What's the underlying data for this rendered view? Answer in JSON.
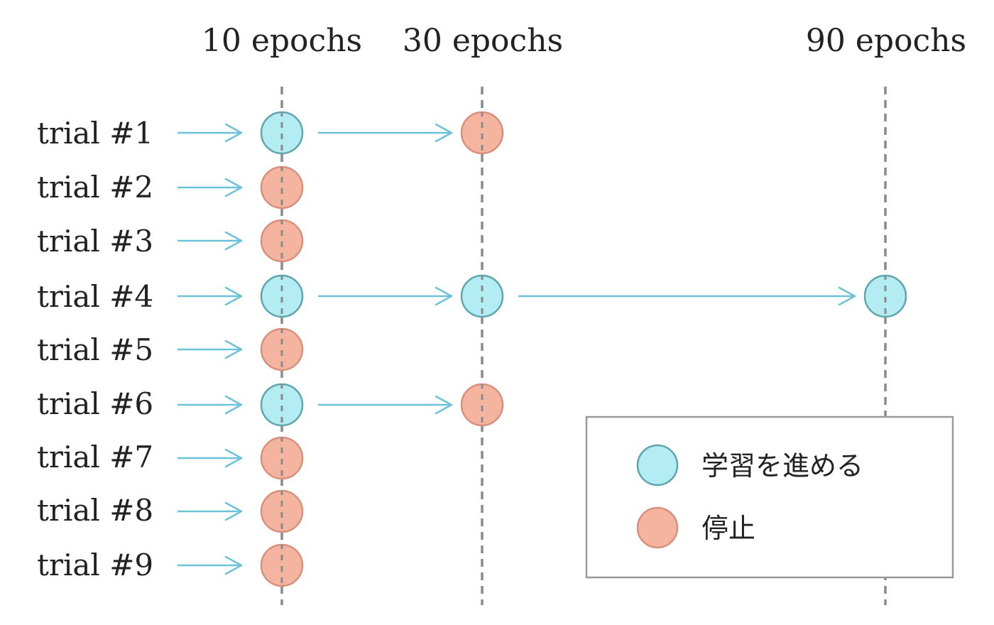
{
  "columns": [
    {
      "label": "10 epochs"
    },
    {
      "label": "30 epochs"
    },
    {
      "label": "90 epochs"
    }
  ],
  "trials": [
    {
      "label": "trial #1",
      "stages": [
        "continue",
        "stop"
      ]
    },
    {
      "label": "trial #2",
      "stages": [
        "stop"
      ]
    },
    {
      "label": "trial #3",
      "stages": [
        "stop"
      ]
    },
    {
      "label": "trial #4",
      "stages": [
        "continue",
        "continue",
        "continue"
      ]
    },
    {
      "label": "trial #5",
      "stages": [
        "stop"
      ]
    },
    {
      "label": "trial #6",
      "stages": [
        "continue",
        "stop"
      ]
    },
    {
      "label": "trial #7",
      "stages": [
        "stop"
      ]
    },
    {
      "label": "trial #8",
      "stages": [
        "stop"
      ]
    },
    {
      "label": "trial #9",
      "stages": [
        "stop"
      ]
    }
  ],
  "legend": {
    "continue_label": "学習を進める",
    "stop_label": "停止"
  },
  "colors": {
    "continue_fill": "#b3ecf2",
    "continue_stroke": "#5fa5ad",
    "stop_fill": "#f5b49f",
    "stop_stroke": "#d98f7c",
    "arrow": "#6cc3d8",
    "guide": "#8a8a8a"
  }
}
